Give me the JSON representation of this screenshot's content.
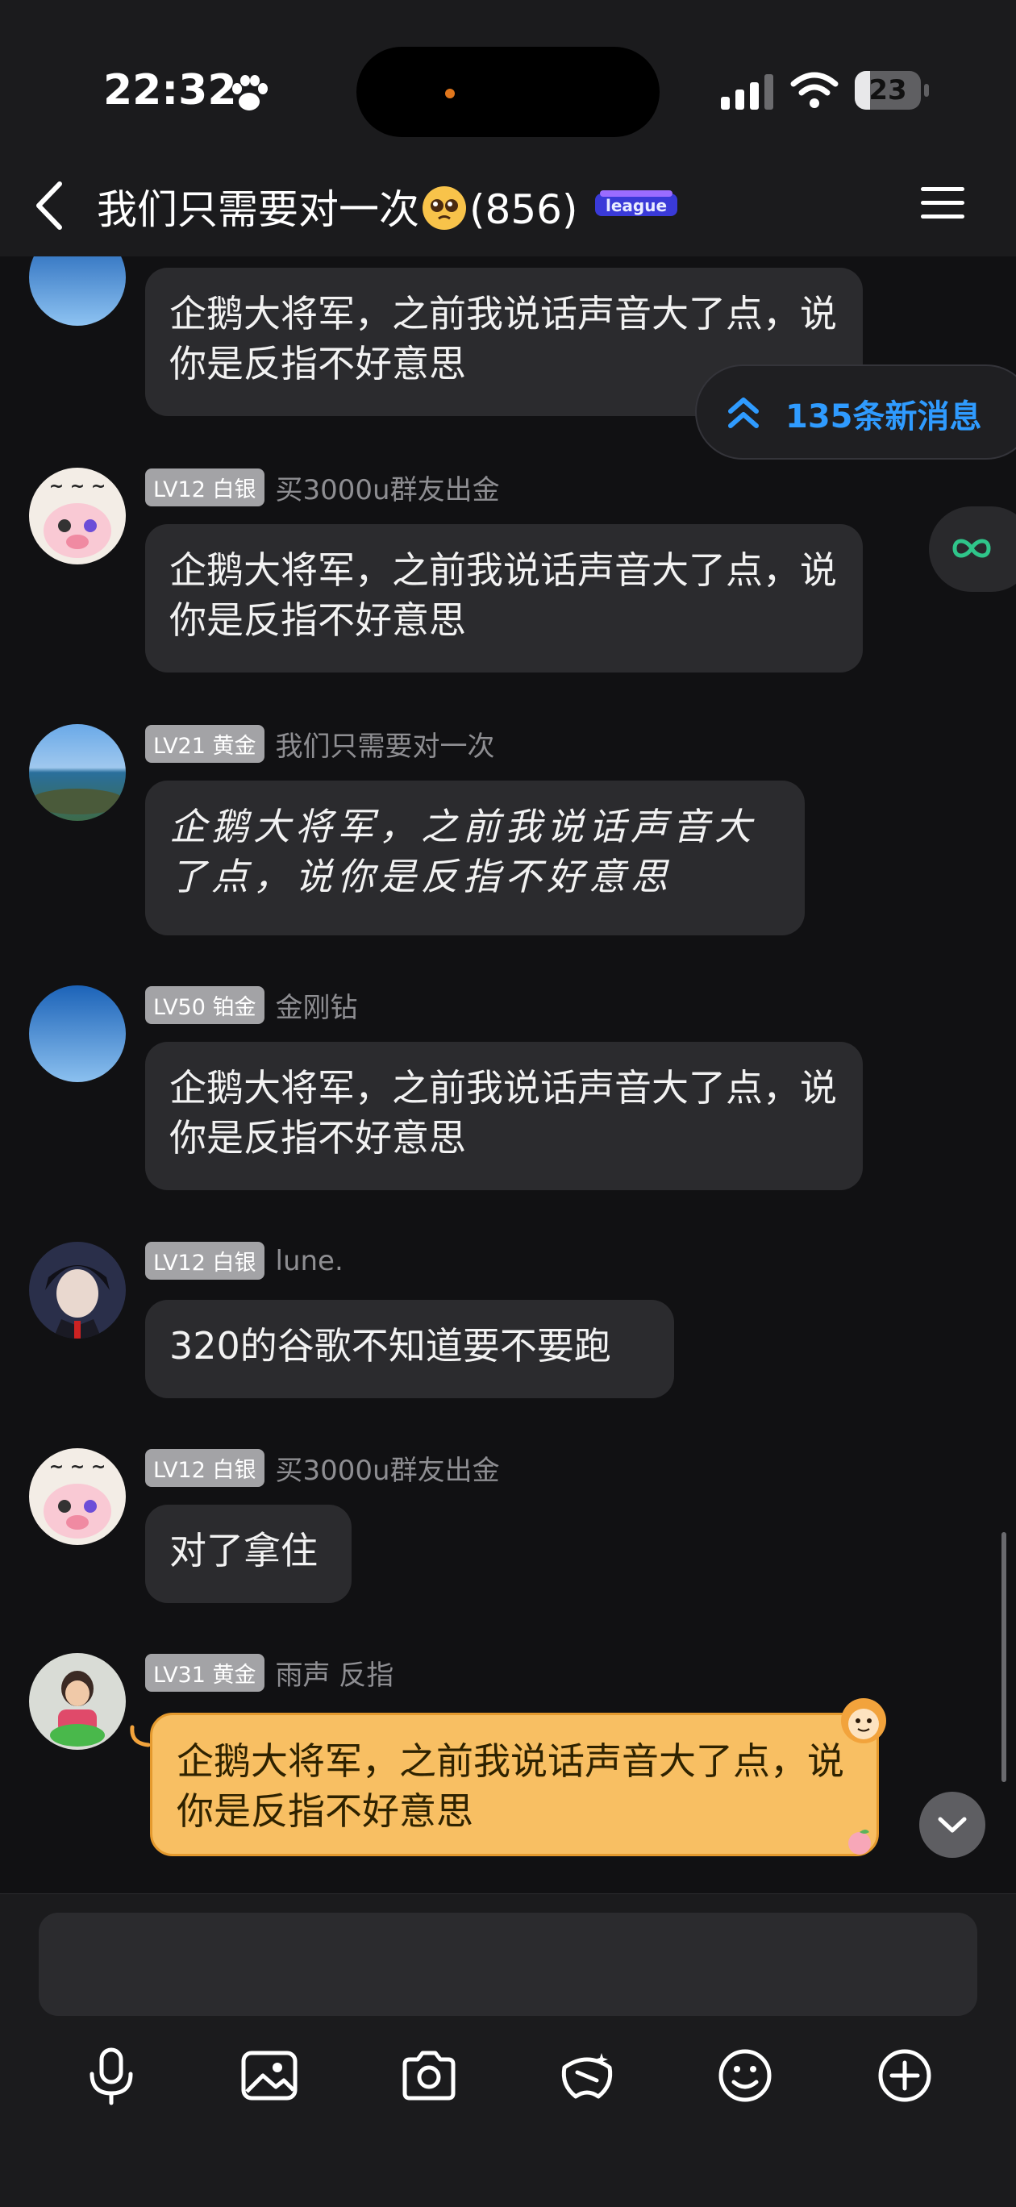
{
  "status_bar": {
    "time": "22:32",
    "battery": "23",
    "battery_level": 0.23
  },
  "header": {
    "title": "我们只需要对一次",
    "member_count": "(856)",
    "league_badge": "league"
  },
  "new_messages": "135条新消息",
  "messages": [
    {
      "level": "",
      "title": "",
      "sender": "",
      "text": "企鹅大将军，之前我说话声音大了点，说你是反指不好意思"
    },
    {
      "level": "LV12",
      "title": "白银",
      "sender": "买3000u群友出金",
      "text": "企鹅大将军，之前我说话声音大了点，说你是反指不好意思"
    },
    {
      "level": "LV21",
      "title": "黄金",
      "sender": "我们只需要对一次",
      "text": "企鹅大将军，之前我说话声音大了点，说你是反指不好意思"
    },
    {
      "level": "LV50",
      "title": "铂金",
      "sender": "金刚钻",
      "text": "企鹅大将军，之前我说话声音大了点，说你是反指不好意思"
    },
    {
      "level": "LV12",
      "title": "白银",
      "sender": "lune.",
      "text": "320的谷歌不知道要不要跑"
    },
    {
      "level": "LV12",
      "title": "白银",
      "sender": "买3000u群友出金",
      "text": "对了拿住"
    },
    {
      "level": "LV31",
      "title": "黄金",
      "sender": "雨声 反指",
      "text": "企鹅大将军，之前我说话声音大了点，说你是反指不好意思"
    }
  ],
  "input": {
    "placeholder": "",
    "value": ""
  },
  "toolbar": [
    "microphone-icon",
    "image-icon",
    "camera-icon",
    "game-icon",
    "emoji-icon",
    "plus-icon"
  ],
  "colors": {
    "accent": "#2f9bff",
    "bubble": "#2b2b2e",
    "yellow_bubble": "#f8bf63",
    "background": "#111113"
  }
}
